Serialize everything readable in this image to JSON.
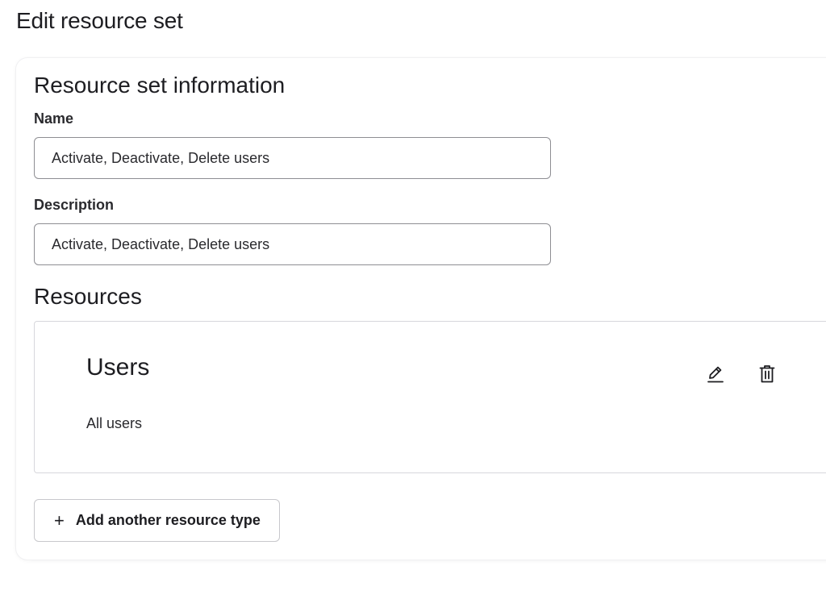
{
  "page": {
    "title": "Edit resource set"
  },
  "info_section": {
    "title": "Resource set information",
    "name_label": "Name",
    "name_value": "Activate, Deactivate, Delete users",
    "description_label": "Description",
    "description_value": "Activate, Deactivate, Delete users"
  },
  "resources_section": {
    "title": "Resources",
    "items": [
      {
        "name": "Users",
        "description": "All users",
        "edit_icon": "pencil-icon",
        "delete_icon": "trash-icon"
      }
    ],
    "add_button_icon": "plus-icon",
    "add_button_label": "Add another resource type"
  },
  "colors": {
    "text": "#1d1d21",
    "input_border": "#8e8e93",
    "box_border": "#d7d7dc"
  }
}
